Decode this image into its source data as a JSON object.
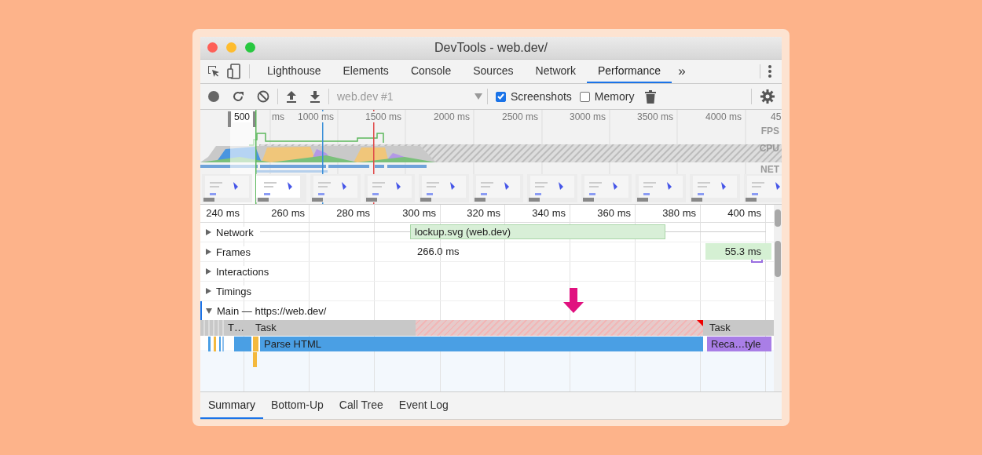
{
  "window": {
    "title": "DevTools - web.dev/"
  },
  "tabs": [
    {
      "label": "Lighthouse",
      "selected": false
    },
    {
      "label": "Elements",
      "selected": false
    },
    {
      "label": "Console",
      "selected": false
    },
    {
      "label": "Sources",
      "selected": false
    },
    {
      "label": "Network",
      "selected": false
    },
    {
      "label": "Performance",
      "selected": true
    }
  ],
  "more_tabs": "»",
  "toolbar": {
    "recording_target": "web.dev #1",
    "checkboxes": [
      {
        "label": "Screenshots",
        "checked": true
      },
      {
        "label": "Memory",
        "checked": false
      }
    ]
  },
  "overview": {
    "selection_label": "500",
    "ruler": [
      "ms",
      "1000 ms",
      "1500 ms",
      "2000 ms",
      "2500 ms",
      "3000 ms",
      "3500 ms",
      "4000 ms",
      "45"
    ],
    "tracks": [
      "FPS",
      "CPU",
      "NET"
    ]
  },
  "timeline": {
    "ruler": [
      "240 ms",
      "260 ms",
      "280 ms",
      "300 ms",
      "320 ms",
      "340 ms",
      "360 ms",
      "380 ms",
      "400 ms"
    ],
    "tracks": [
      {
        "label": "Network",
        "expanded": false,
        "bars": [
          {
            "label": "lockup.svg (web.dev)"
          }
        ]
      },
      {
        "label": "Frames",
        "expanded": false,
        "frames": [
          {
            "label": "266.0 ms",
            "kind": "idle"
          },
          {
            "label": "55.3 ms",
            "kind": "drawn"
          }
        ]
      },
      {
        "label": "Interactions",
        "expanded": false
      },
      {
        "label": "Timings",
        "expanded": false
      }
    ],
    "main": {
      "label": "Main — https://web.dev/",
      "expanded": true,
      "tasks": [
        {
          "label": "T…",
          "long": false
        },
        {
          "label": "Task",
          "long": true
        },
        {
          "label": "Task",
          "long": false
        }
      ],
      "calls": [
        {
          "label": "Parse HTML",
          "kind": "parse"
        },
        {
          "label": "Reca…tyle",
          "kind": "style"
        }
      ]
    }
  },
  "bottom_tabs": [
    {
      "label": "Summary",
      "selected": true
    },
    {
      "label": "Bottom-Up",
      "selected": false
    },
    {
      "label": "Call Tree",
      "selected": false
    },
    {
      "label": "Event Log",
      "selected": false
    }
  ]
}
